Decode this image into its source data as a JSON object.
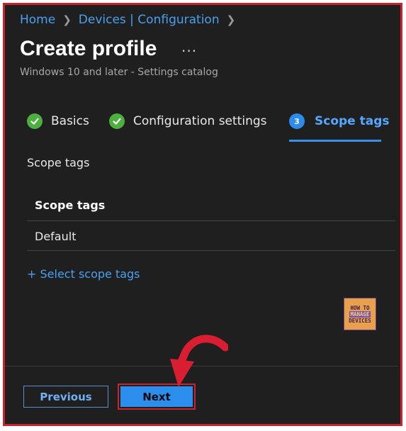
{
  "breadcrumb": {
    "home": "Home",
    "devices_config": "Devices | Configuration"
  },
  "page": {
    "title": "Create profile",
    "more": "···",
    "subtitle": "Windows 10 and later - Settings catalog"
  },
  "steps": [
    {
      "label": "Basics",
      "state": "complete"
    },
    {
      "label": "Configuration settings",
      "state": "complete"
    },
    {
      "label": "Scope tags",
      "number": "3",
      "state": "active"
    }
  ],
  "scope": {
    "section_label": "Scope tags",
    "table_header": "Scope tags",
    "rows": [
      "Default"
    ],
    "select_link": "+ Select scope tags"
  },
  "logo": {
    "line1": "HOW TO",
    "line2": "MANAGE",
    "line3": "DEVICES"
  },
  "footer": {
    "previous": "Previous",
    "next": "Next"
  },
  "colors": {
    "accent": "#2c8fee",
    "highlight": "#c8242f",
    "success": "#4caf3f",
    "background": "#1f1f1f"
  }
}
